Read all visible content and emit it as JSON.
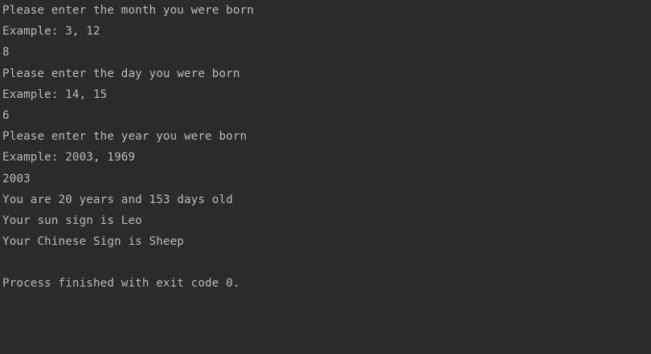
{
  "console": {
    "lines": [
      {
        "kind": "output",
        "text": "Please enter the month you were born"
      },
      {
        "kind": "output",
        "text": "Example: 3, 12"
      },
      {
        "kind": "input",
        "text": "8"
      },
      {
        "kind": "output",
        "text": "Please enter the day you were born"
      },
      {
        "kind": "output",
        "text": "Example: 14, 15"
      },
      {
        "kind": "input",
        "text": "6"
      },
      {
        "kind": "output",
        "text": "Please enter the year you were born"
      },
      {
        "kind": "output",
        "text": "Example: 2003, 1969"
      },
      {
        "kind": "input",
        "text": "2003"
      },
      {
        "kind": "output",
        "text": "You are 20 years and 153 days old"
      },
      {
        "kind": "output",
        "text": "Your sun sign is Leo"
      },
      {
        "kind": "output",
        "text": "Your Chinese Sign is Sheep"
      },
      {
        "kind": "blank",
        "text": ""
      },
      {
        "kind": "process",
        "text": "Process finished with exit code 0."
      }
    ]
  },
  "colors": {
    "background": "#2b2b2b",
    "text": "#bbbbbb"
  }
}
